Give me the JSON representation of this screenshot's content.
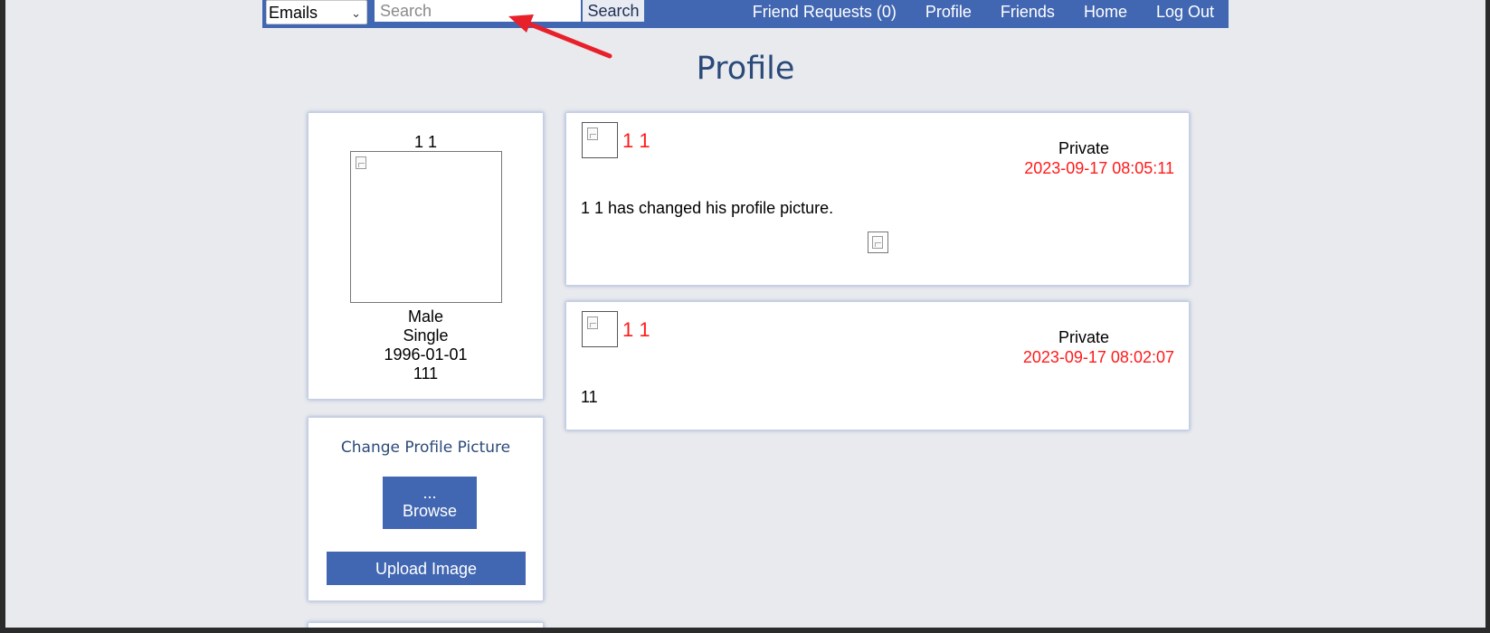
{
  "navbar": {
    "select_value": "Emails",
    "search_placeholder": "Search",
    "search_button": "Search",
    "links": [
      "Friend Requests (0)",
      "Profile",
      "Friends",
      "Home",
      "Log Out"
    ]
  },
  "page_title": "Profile",
  "profile": {
    "name": "1 1",
    "gender": "Male",
    "status": "Single",
    "birthdate": "1996-01-01",
    "extra": "111"
  },
  "upload": {
    "change_label": "Change Profile Picture",
    "browse_dots": "...",
    "browse_label": "Browse",
    "upload_label": "Upload Image"
  },
  "posts": [
    {
      "author": "1 1",
      "privacy": "Private",
      "timestamp": "2023-09-17 08:05:11",
      "text": "1 1 has changed his profile picture."
    },
    {
      "author": "1 1",
      "privacy": "Private",
      "timestamp": "2023-09-17 08:02:07",
      "text": "11"
    }
  ],
  "colors": {
    "brand_blue": "#4267b2",
    "background": "#e8eaee",
    "accent_red": "#ff1a1a",
    "annotation_arrow": "#e8202a"
  },
  "icons": [
    "chevron-down-icon",
    "broken-image-icon",
    "annotation-arrow"
  ]
}
